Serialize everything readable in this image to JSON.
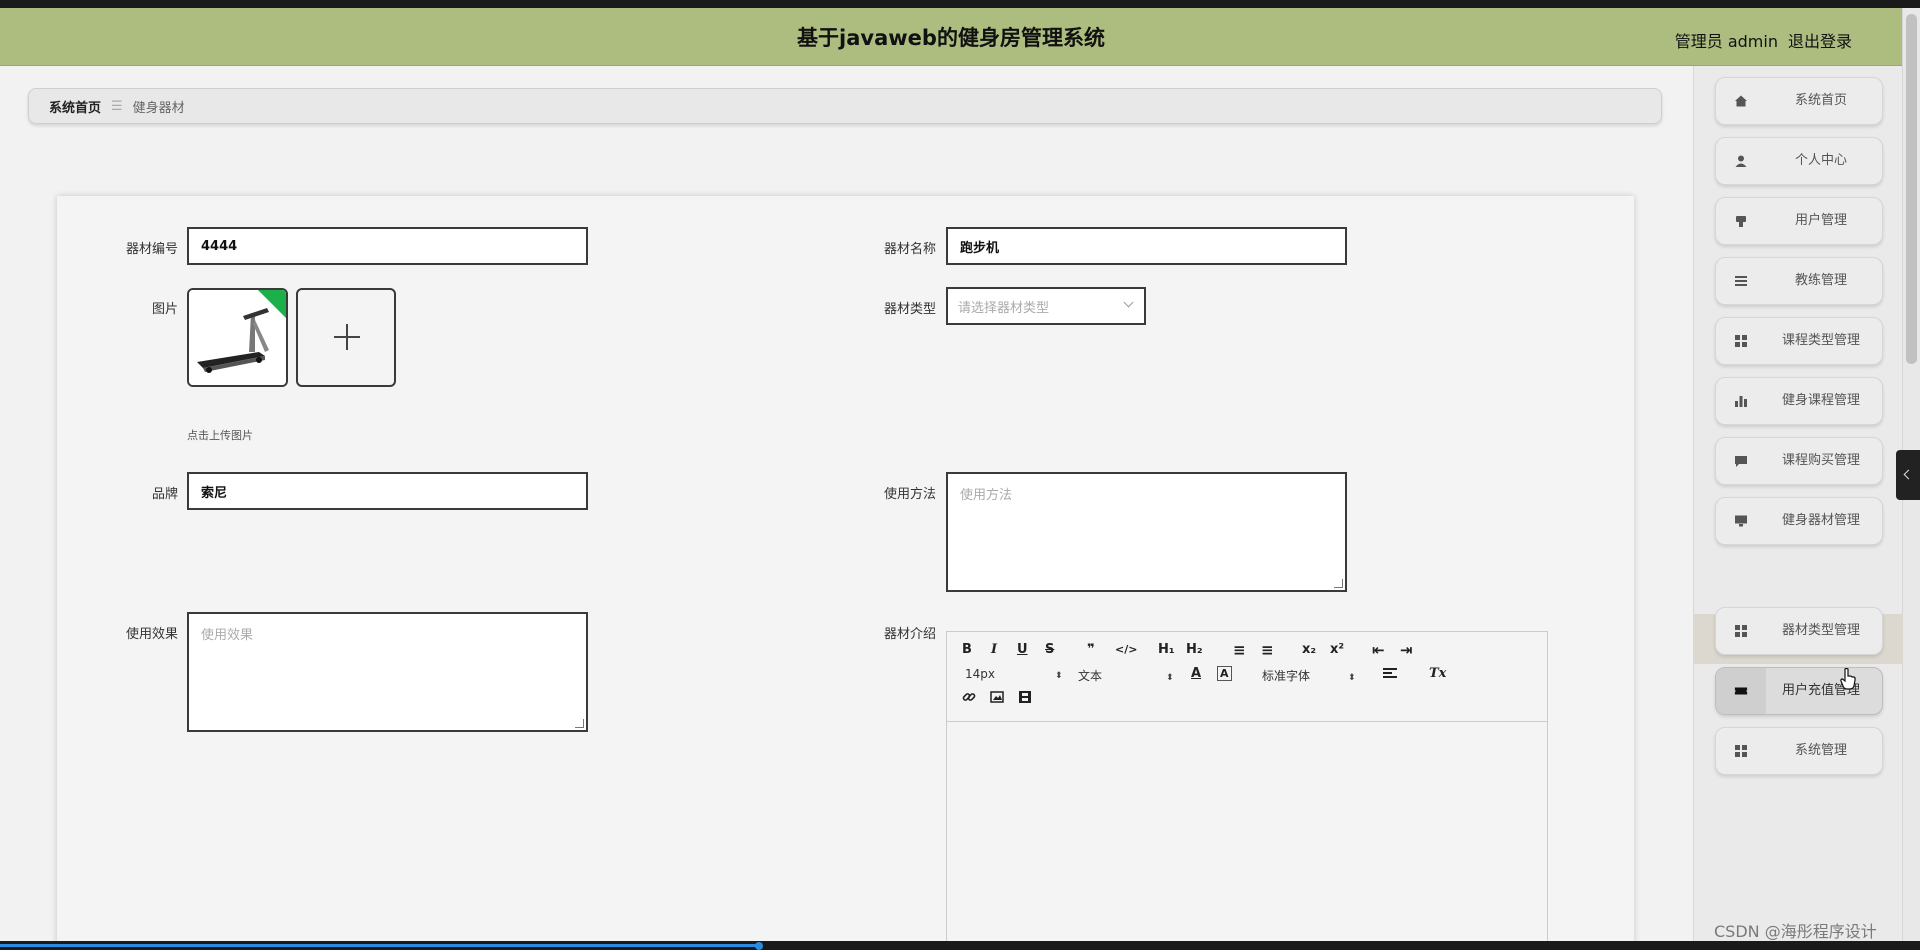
{
  "header": {
    "title": "基于javaweb的健身房管理系统",
    "user_label": "管理员 admin",
    "logout_label": "退出登录"
  },
  "breadcrumb": {
    "home": "系统首页",
    "separator": "☰",
    "current": "健身器材"
  },
  "form": {
    "equipment_no": {
      "label": "器材编号",
      "value": "4444"
    },
    "equipment_name": {
      "label": "器材名称",
      "value": "跑步机"
    },
    "image": {
      "label": "图片",
      "upload_hint": "点击上传图片"
    },
    "equipment_type": {
      "label": "器材类型",
      "placeholder": "请选择器材类型"
    },
    "brand": {
      "label": "品牌",
      "value": "索尼"
    },
    "usage_method": {
      "label": "使用方法",
      "placeholder": "使用方法"
    },
    "usage_effect": {
      "label": "使用效果",
      "placeholder": "使用效果"
    },
    "introduction": {
      "label": "器材介绍"
    }
  },
  "editor": {
    "font_size": "14px",
    "block_format": "文本",
    "font_family": "标准字体",
    "buttons": {
      "bold": "B",
      "italic": "I",
      "underline": "U",
      "strike": "S",
      "quote": "❞",
      "code": "</>",
      "h1": "H₁",
      "h2": "H₂",
      "ordered_list": "≡",
      "bullet_list": "≡",
      "subscript": "x₂",
      "superscript": "x²",
      "outdent": "⇤",
      "indent": "⇥",
      "color": "A",
      "bg_color": "A",
      "clear": "Tx",
      "link": "🔗",
      "image": "▣",
      "video": "▤"
    }
  },
  "sidebar": {
    "items": [
      {
        "label": "系统首页",
        "icon": "home-icon"
      },
      {
        "label": "个人中心",
        "icon": "user-icon"
      },
      {
        "label": "用户管理",
        "icon": "user-mgmt-icon"
      },
      {
        "label": "教练管理",
        "icon": "list-icon"
      },
      {
        "label": "课程类型管理",
        "icon": "grid-icon"
      },
      {
        "label": "健身课程管理",
        "icon": "bar-chart-icon"
      },
      {
        "label": "课程购买管理",
        "icon": "chat-icon"
      },
      {
        "label": "健身器材管理",
        "icon": "monitor-icon"
      },
      {
        "label": "器材类型管理",
        "icon": "grid-icon"
      },
      {
        "label": "用户充值管理",
        "icon": "ticket-icon"
      },
      {
        "label": "系统管理",
        "icon": "grid-icon"
      }
    ],
    "active_sub_item": "健身器材"
  },
  "watermark": "CSDN @海彤程序设计"
}
